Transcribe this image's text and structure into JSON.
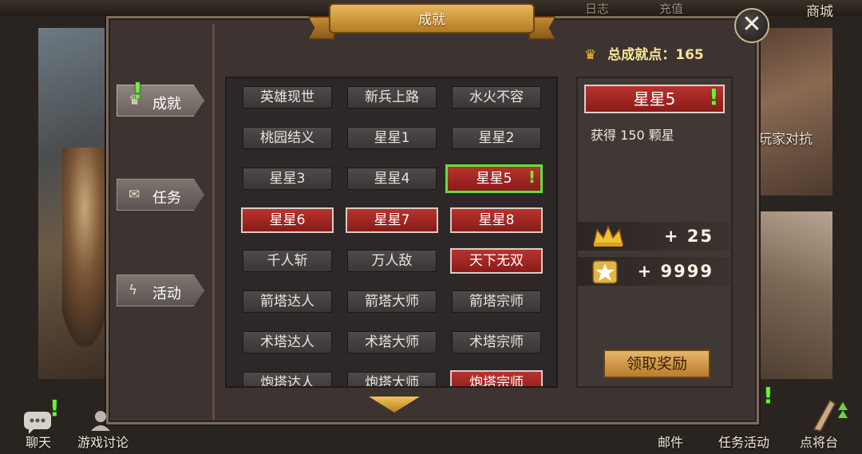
{
  "top_nav": {
    "mail_label": "日志",
    "recharge_label": "充值",
    "shop_label": "商城"
  },
  "background": {
    "pvp_label": "玩家对抗"
  },
  "dialog": {
    "title": "成就",
    "total_points_label": "总成就点：",
    "total_points_value": "165"
  },
  "tabs": [
    {
      "label": "成就",
      "icon": "crown-icon",
      "active": true,
      "alert": true
    },
    {
      "label": "任务",
      "icon": "scroll-icon",
      "active": false,
      "alert": false
    },
    {
      "label": "活动",
      "icon": "lightning-icon",
      "active": false,
      "alert": false
    }
  ],
  "achievements": [
    {
      "label": "英雄现世",
      "state": "normal"
    },
    {
      "label": "新兵上路",
      "state": "normal"
    },
    {
      "label": "水火不容",
      "state": "normal"
    },
    {
      "label": "桃园结义",
      "state": "normal"
    },
    {
      "label": "星星1",
      "state": "normal"
    },
    {
      "label": "星星2",
      "state": "normal"
    },
    {
      "label": "星星3",
      "state": "normal"
    },
    {
      "label": "星星4",
      "state": "normal"
    },
    {
      "label": "星星5",
      "state": "selected",
      "alert": true
    },
    {
      "label": "星星6",
      "state": "red"
    },
    {
      "label": "星星7",
      "state": "red"
    },
    {
      "label": "星星8",
      "state": "red"
    },
    {
      "label": "千人斩",
      "state": "normal"
    },
    {
      "label": "万人敌",
      "state": "normal"
    },
    {
      "label": "天下无双",
      "state": "red"
    },
    {
      "label": "箭塔达人",
      "state": "normal"
    },
    {
      "label": "箭塔大师",
      "state": "normal"
    },
    {
      "label": "箭塔宗师",
      "state": "normal"
    },
    {
      "label": "术塔达人",
      "state": "normal"
    },
    {
      "label": "术塔大师",
      "state": "normal"
    },
    {
      "label": "术塔宗师",
      "state": "normal"
    },
    {
      "label": "炮塔达人",
      "state": "normal"
    },
    {
      "label": "炮塔大师",
      "state": "normal"
    },
    {
      "label": "炮塔宗师",
      "state": "red"
    }
  ],
  "detail": {
    "title": "星星5",
    "description": "获得 150 颗星",
    "reward_points": "+ 25",
    "reward_stars": "+ 9999",
    "claim_label": "领取奖励"
  },
  "bottom_bar": {
    "chat_label": "聊天",
    "forum_label": "游戏讨论",
    "mail_label": "邮件",
    "task_activity_label": "任务活动",
    "general_label": "点将台"
  },
  "colors": {
    "accent_gold": "#e6b85a",
    "achieved_red": "#b8332e",
    "selected_green": "#5fdf3d",
    "alert_green": "#6ef03a"
  }
}
